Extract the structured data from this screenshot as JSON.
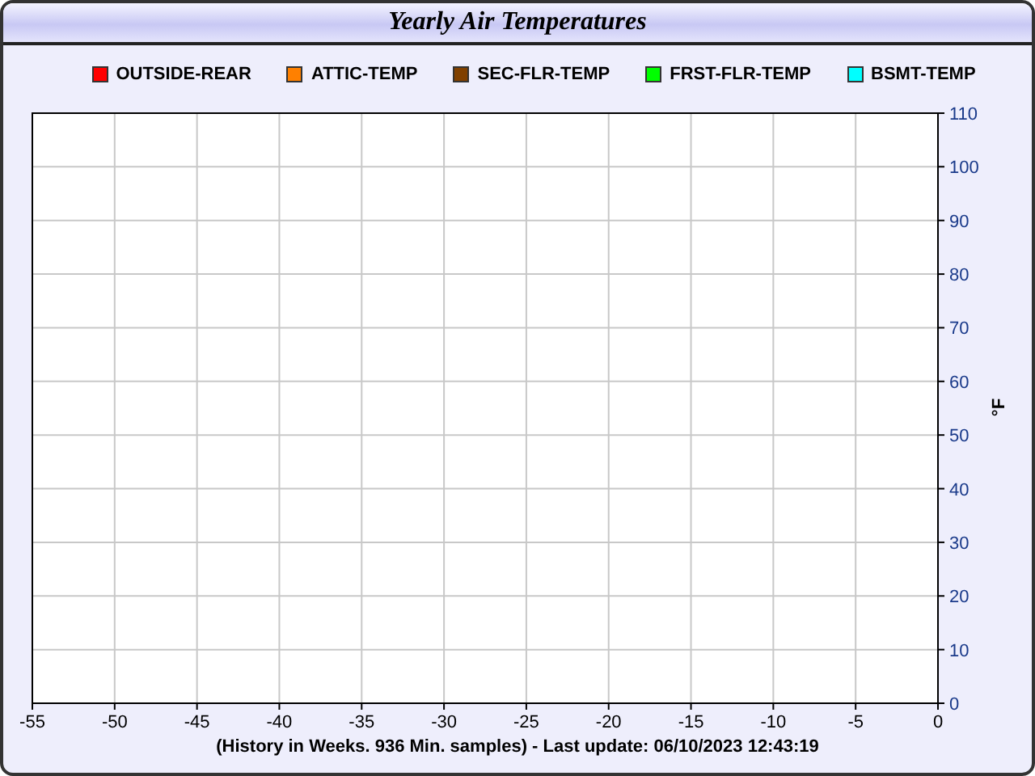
{
  "chart_data": {
    "type": "line",
    "grid": true,
    "title": "Yearly Air Temperatures",
    "xlabel": "(History in Weeks. 936 Min. samples) - Last update: 06/10/2023 12:43:19",
    "ylabel": "°F",
    "series": [
      {
        "name": "OUTSIDE-REAR",
        "color": "#ff0000",
        "values": [
          null,
          null,
          null,
          null,
          null,
          null,
          null,
          null,
          null,
          null,
          null,
          null
        ]
      },
      {
        "name": "ATTIC-TEMP",
        "color": "#ff8000",
        "values": [
          null,
          null,
          null,
          null,
          null,
          null,
          null,
          null,
          null,
          null,
          null,
          null
        ]
      },
      {
        "name": "SEC-FLR-TEMP",
        "color": "#804000",
        "values": [
          null,
          null,
          null,
          null,
          null,
          null,
          null,
          null,
          null,
          null,
          null,
          null
        ]
      },
      {
        "name": "FRST-FLR-TEMP",
        "color": "#00ff00",
        "values": [
          null,
          null,
          null,
          null,
          null,
          null,
          null,
          null,
          null,
          null,
          null,
          null
        ]
      },
      {
        "name": "BSMT-TEMP",
        "color": "#00ffff",
        "values": [
          null,
          null,
          null,
          null,
          null,
          null,
          null,
          null,
          null,
          null,
          null,
          null
        ]
      }
    ],
    "categories": [
      "-55",
      "-50",
      "-45",
      "-40",
      "-35",
      "-30",
      "-25",
      "-20",
      "-15",
      "-10",
      "-5",
      "0"
    ],
    "ylim": [
      0,
      110
    ],
    "yticks": [
      0,
      10,
      20,
      30,
      40,
      50,
      60,
      70,
      80,
      90,
      100,
      110
    ]
  }
}
